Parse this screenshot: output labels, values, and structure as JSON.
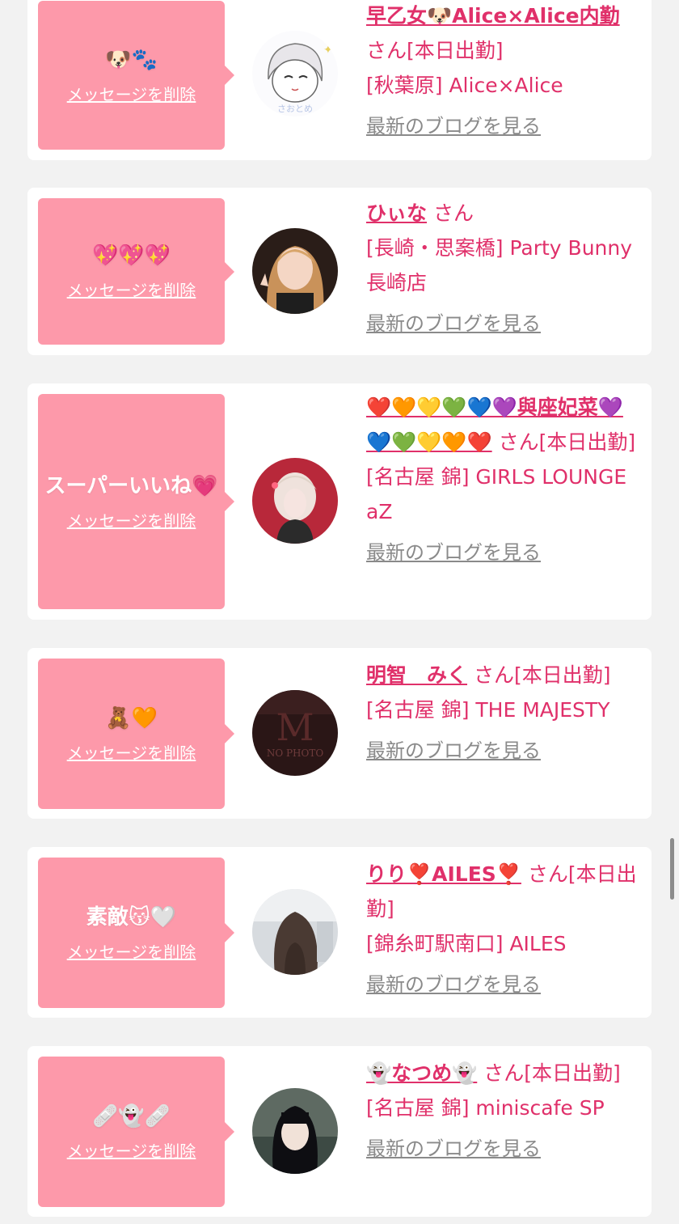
{
  "delete_label": "メッセージを削除",
  "blog_label": "最新のブログを見る",
  "san_label": "さん",
  "cards": [
    {
      "stamp": "🐶🐾",
      "name": "早乙女🐶Alice×Alice内勤",
      "status": "[本日出勤]",
      "shop": "[秋葉原] Alice×Alice",
      "avatar": "illustration-avatar"
    },
    {
      "stamp": "💖💖💖",
      "name": "ひぃな",
      "status": "",
      "shop": "[長崎・思案橋] Party Bunny 長崎店",
      "avatar": "photo-avatar"
    },
    {
      "stamp": "スーパーいいね💗",
      "name": "❤️🧡💛💚💙💜與座妃菜💜💙💚💛🧡❤️",
      "status": "[本日出勤]",
      "shop": "[名古屋 錦] GIRLS LOUNGE aZ",
      "avatar": "photo-avatar"
    },
    {
      "stamp": "🧸🧡",
      "name": "明智　みく",
      "status": "[本日出勤]",
      "shop": "[名古屋 錦] THE MAJESTY",
      "avatar": "no-photo-avatar"
    },
    {
      "stamp": "素敵😽🤍",
      "name": "りり❣️AILES❣️",
      "status": "[本日出勤]",
      "shop": "[錦糸町駅南口] AILES",
      "avatar": "photo-avatar"
    },
    {
      "stamp": "🩹👻🩹",
      "name": "👻なつめ👻",
      "status": "[本日出勤]",
      "shop": "[名古屋 錦] miniscafe SP",
      "avatar": "photo-avatar"
    }
  ]
}
